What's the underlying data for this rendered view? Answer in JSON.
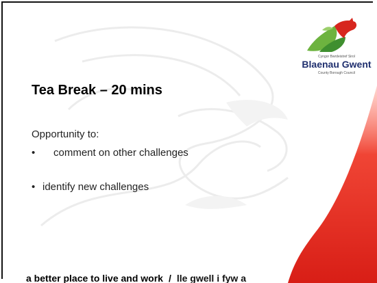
{
  "logo": {
    "top_line": "Cyngor Bwrdeistref Sirol",
    "name": "Blaenau Gwent",
    "bottom_line": "County Borough Council"
  },
  "slide": {
    "title": "Tea Break – 20 mins",
    "intro": "Opportunity to:",
    "bullets": [
      {
        "marker": "•",
        "text": "comment on other challenges"
      },
      {
        "marker": "•",
        "text": "identify new challenges"
      }
    ]
  },
  "footer": {
    "english": "a better place to  live and work",
    "separator": "/",
    "welsh": "lle gwell i fyw a"
  },
  "colors": {
    "accent_red": "#e2261c",
    "logo_green": "#5aa03c",
    "logo_blue": "#1f2f6e"
  }
}
